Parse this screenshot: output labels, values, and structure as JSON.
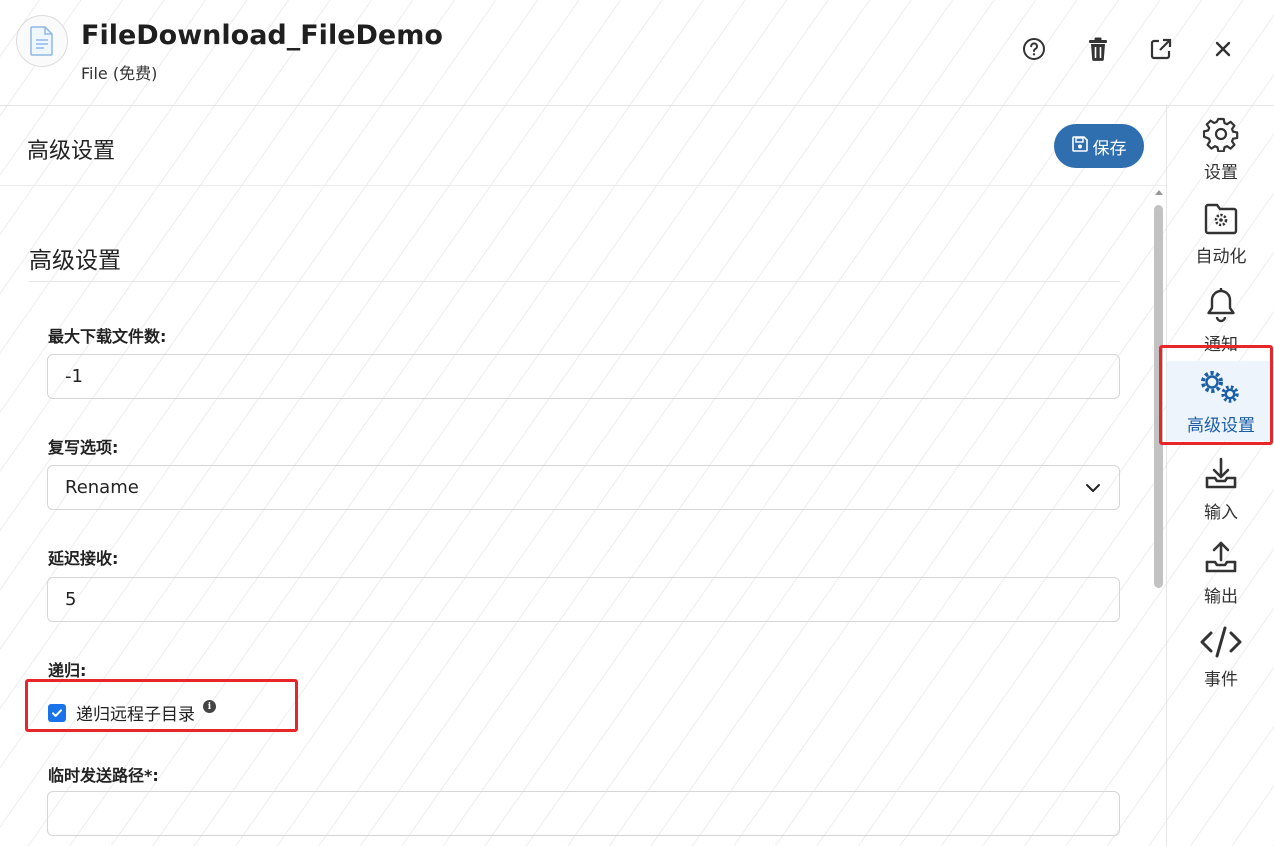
{
  "header": {
    "title": "FileDownload_FileDemo",
    "subtitle": "File (免费)",
    "icons": [
      "help-icon",
      "delete-icon",
      "external-link-icon",
      "close-icon"
    ]
  },
  "panel": {
    "title": "高级设置",
    "save_label": "保存",
    "section_title": "高级设置"
  },
  "form": {
    "max_files": {
      "label": "最大下载文件数:",
      "value": "-1"
    },
    "overwrite": {
      "label": "复写选项:",
      "value": "Rename"
    },
    "delay": {
      "label": "延迟接收:",
      "value": "5"
    },
    "recursive": {
      "label": "递归:",
      "checkbox_label": "递归远程子目录",
      "checked": true
    },
    "temp_path": {
      "label": "临时发送路径*:",
      "value": ""
    }
  },
  "sidebar": {
    "items": [
      {
        "label": "设置",
        "icon": "gear-icon"
      },
      {
        "label": "自动化",
        "icon": "folder-gear-icon"
      },
      {
        "label": "通知",
        "icon": "bell-icon"
      },
      {
        "label": "高级设置",
        "icon": "gears-icon",
        "active": true
      },
      {
        "label": "输入",
        "icon": "download-icon"
      },
      {
        "label": "输出",
        "icon": "upload-icon"
      },
      {
        "label": "事件",
        "icon": "code-icon"
      }
    ]
  },
  "colors": {
    "accent": "#2f6fb0",
    "active_nav": "#1b5ea8",
    "checkbox": "#1a73e8",
    "highlight": "#e8262a"
  }
}
